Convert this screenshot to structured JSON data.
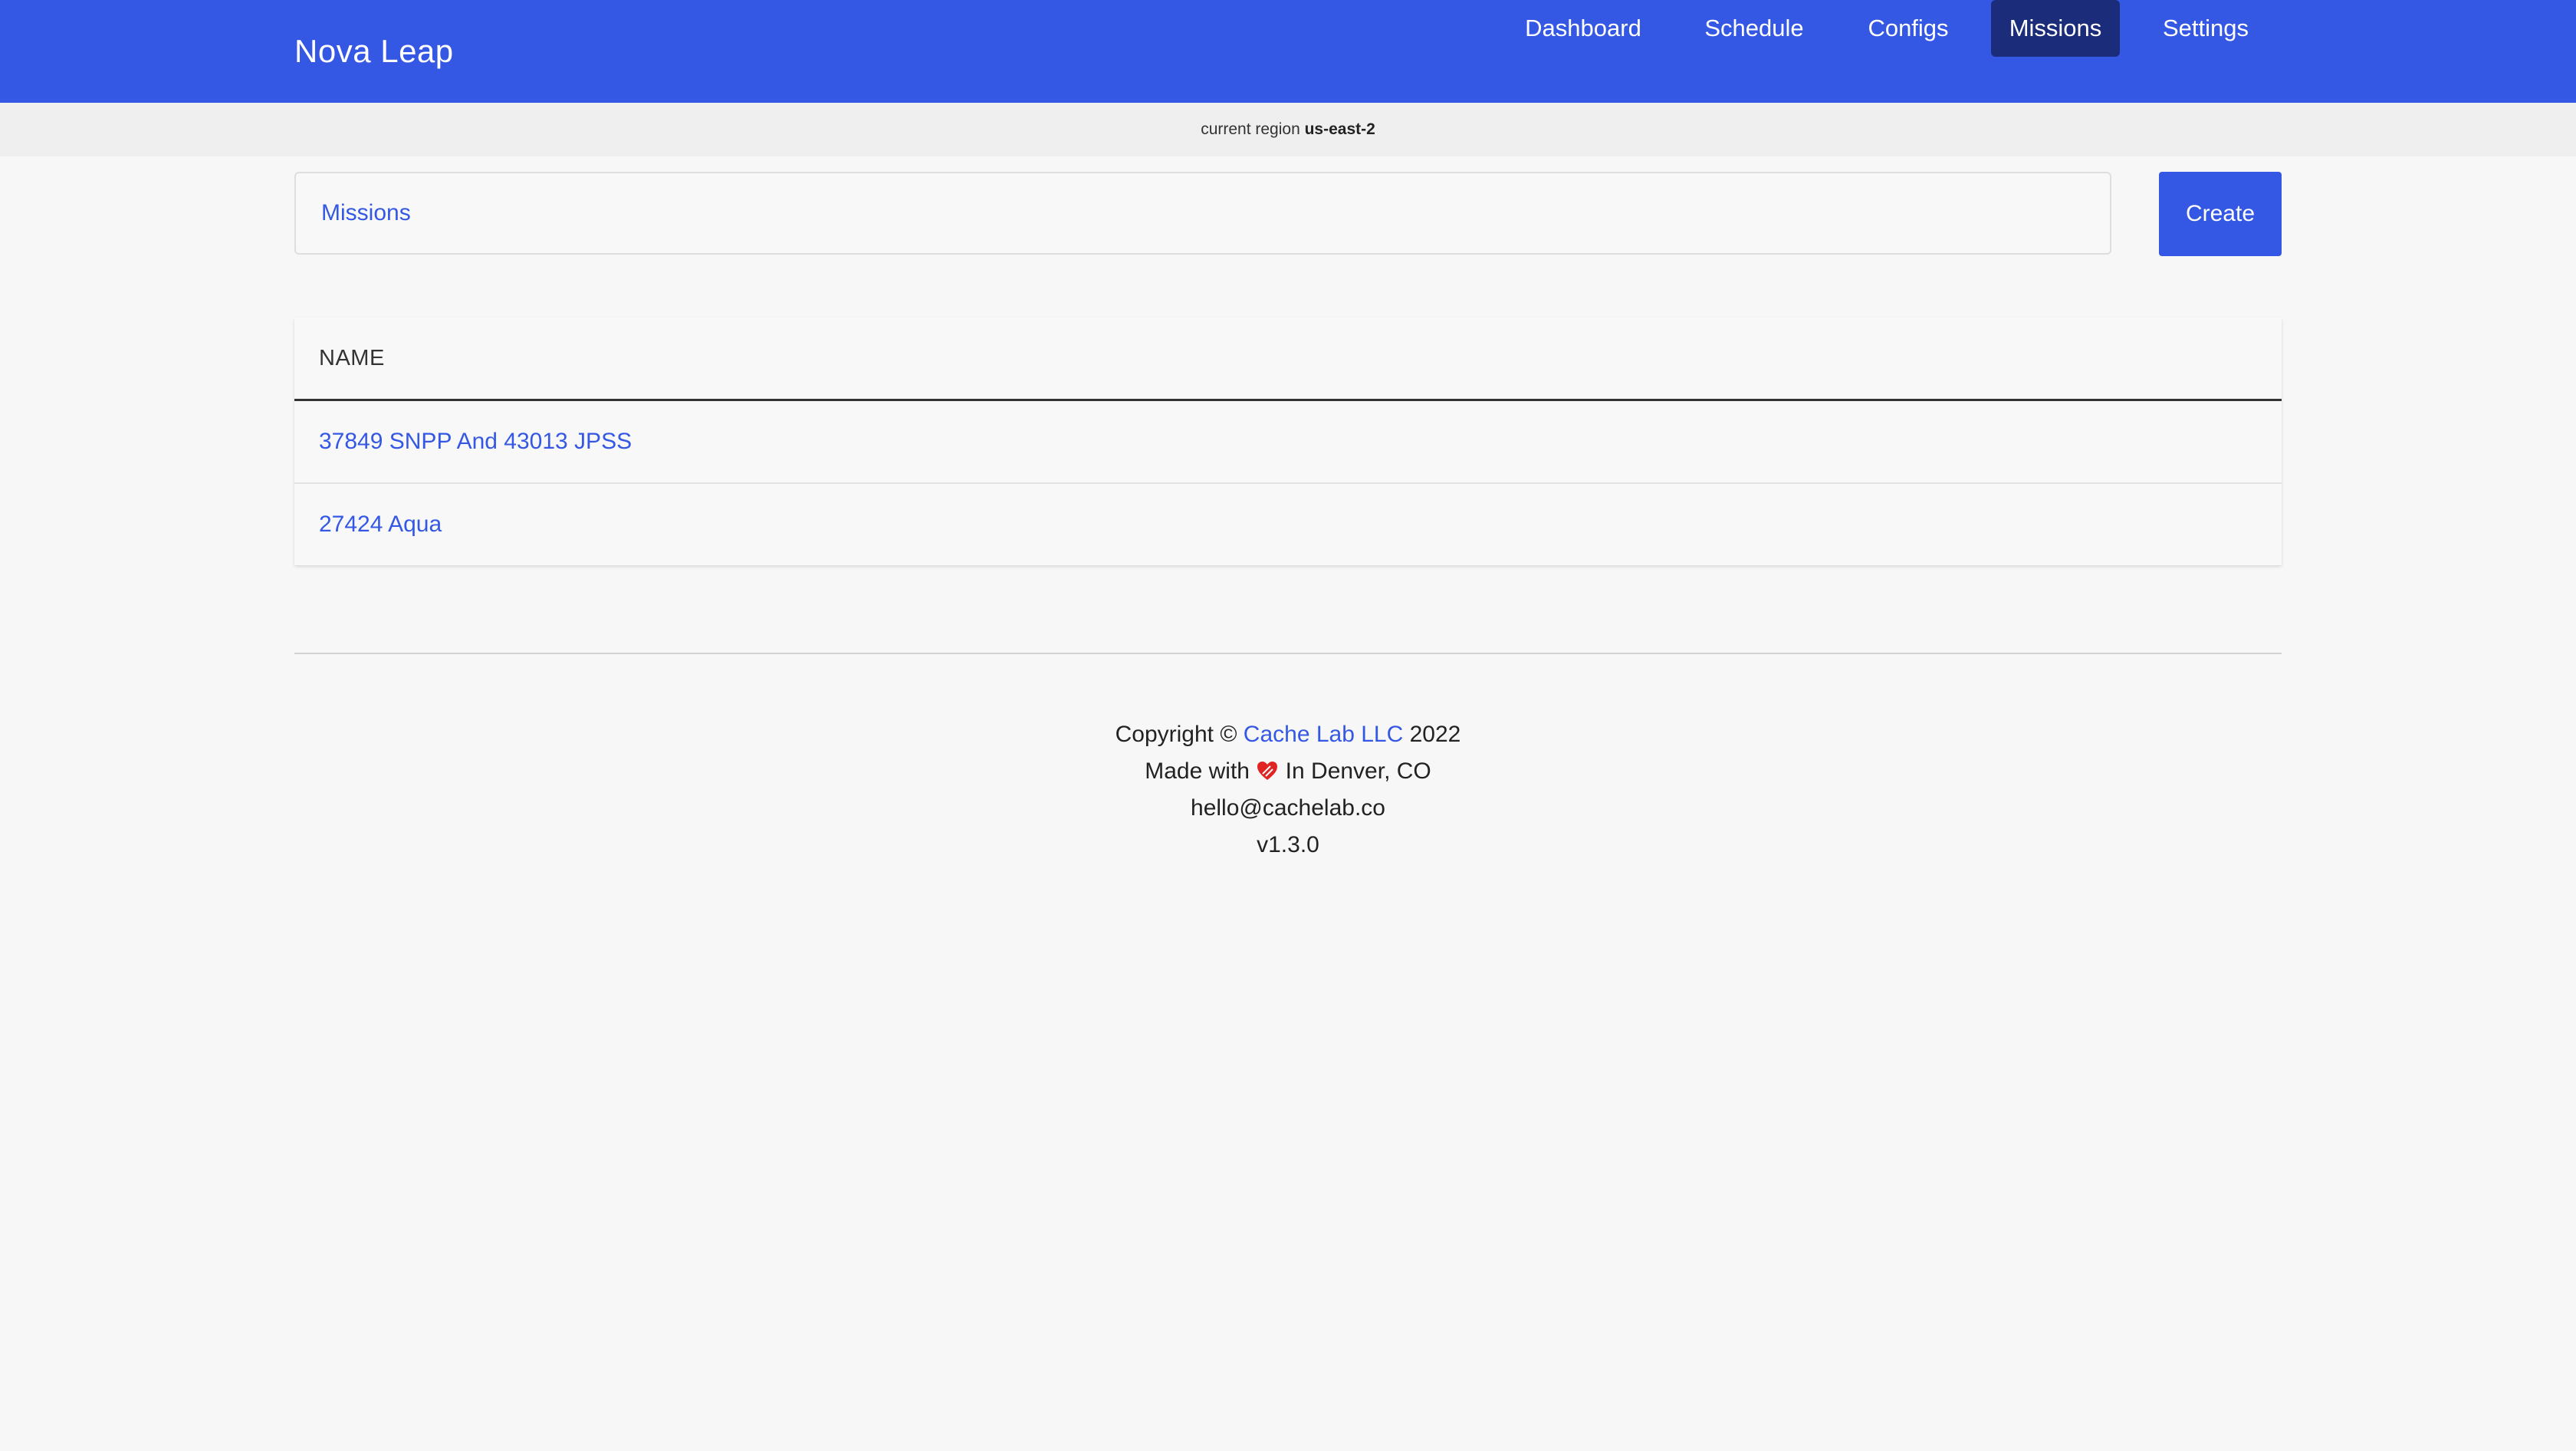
{
  "app": {
    "brand": "Nova Leap"
  },
  "nav": {
    "items": [
      {
        "label": "Dashboard"
      },
      {
        "label": "Schedule"
      },
      {
        "label": "Configs"
      },
      {
        "label": "Missions",
        "active": true
      },
      {
        "label": "Settings"
      }
    ]
  },
  "region": {
    "prefix": "current region",
    "value": "us-east-2"
  },
  "header": {
    "breadcrumb": "Missions",
    "create_label": "Create"
  },
  "table": {
    "column_header": "NAME",
    "rows": [
      {
        "name": "37849 SNPP And 43013 JPSS"
      },
      {
        "name": "27424 Aqua"
      }
    ]
  },
  "footer": {
    "copyright_prefix": "Copyright ©",
    "company": "Cache Lab LLC",
    "year": "2022",
    "made_with": "Made with",
    "location": "In Denver, CO",
    "email": "hello@cachelab.co",
    "version": "v1.3.0"
  },
  "colors": {
    "primary": "#3458e3",
    "nav_active": "#1a2c7a",
    "background": "#f7f7f7",
    "heart": "#e02424"
  }
}
